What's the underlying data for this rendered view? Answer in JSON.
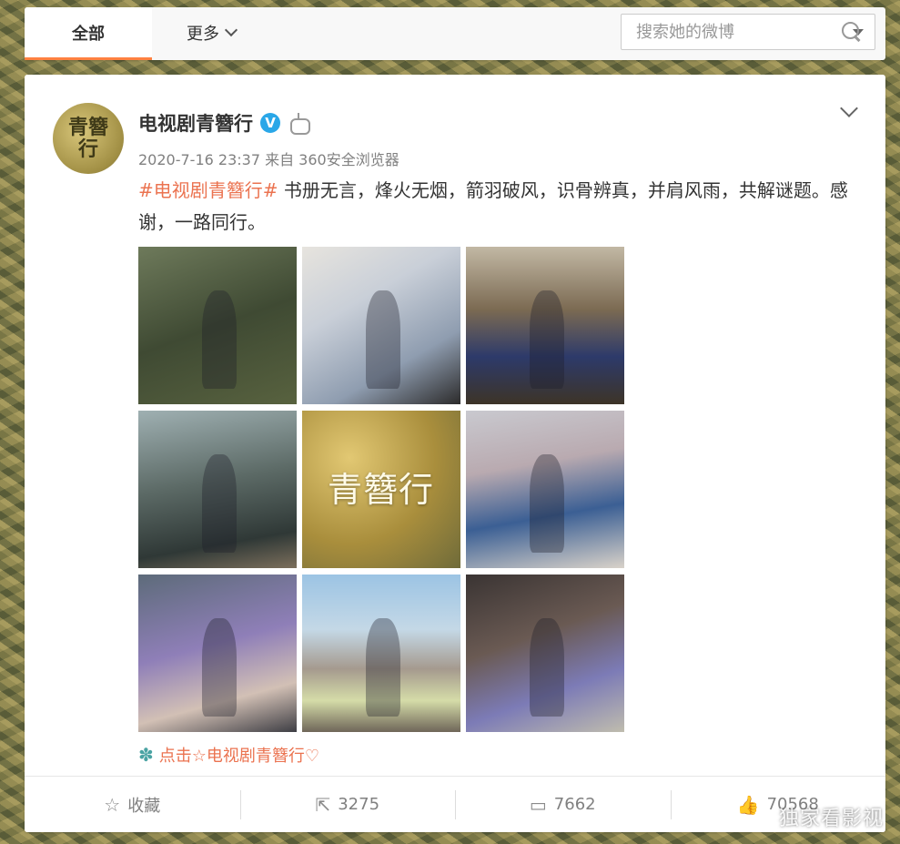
{
  "tabs": {
    "all": "全部",
    "more": "更多"
  },
  "search": {
    "placeholder": "搜索她的微博"
  },
  "post": {
    "author": "电视剧青簪行",
    "avatar_text": "青簪行",
    "meta": "2020-7-16 23:37 来自 360安全浏览器",
    "topic": "#电视剧青簪行#",
    "text": " 书册无言，烽火无烟，箭羽破风，识骨辨真，并肩风雨，共解谜题。感谢，一路同行。",
    "image_title": "青簪行",
    "link_text": "点击☆电视剧青簪行♡"
  },
  "actions": {
    "favorite": "收藏",
    "repost": "3275",
    "comment": "7662",
    "like": "70568"
  },
  "watermark": "独家看影视",
  "colors": {
    "accent": "#ff8140",
    "topic": "#eb7350",
    "verified": "#2aa7e8"
  }
}
